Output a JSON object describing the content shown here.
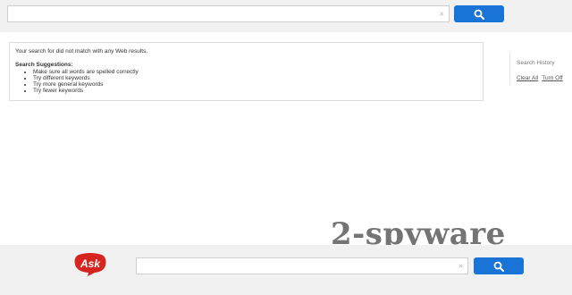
{
  "top_search": {
    "value": "",
    "clear_glyph": "×"
  },
  "results": {
    "no_match_text": "Your search for did not match with any Web results.",
    "suggestions_title": "Search Suggestions:",
    "suggestions": [
      "Make sure all words are spelled correctly",
      "Try different keywords",
      "Try more general keywords",
      "Try fewer keywords"
    ]
  },
  "history": {
    "title": "Search History",
    "clear_all": "Clear All",
    "turn_off": "Turn Off"
  },
  "watermark": "2-spyware",
  "logo": {
    "text": "Ask",
    "color": "#d6251f"
  },
  "bottom_search": {
    "value": "",
    "clear_glyph": "×"
  },
  "colors": {
    "button": "#1a73d6",
    "bar_bg": "#f1f1f1"
  },
  "icons": {
    "search": "magnifier-icon",
    "clear": "clear-x-icon"
  }
}
